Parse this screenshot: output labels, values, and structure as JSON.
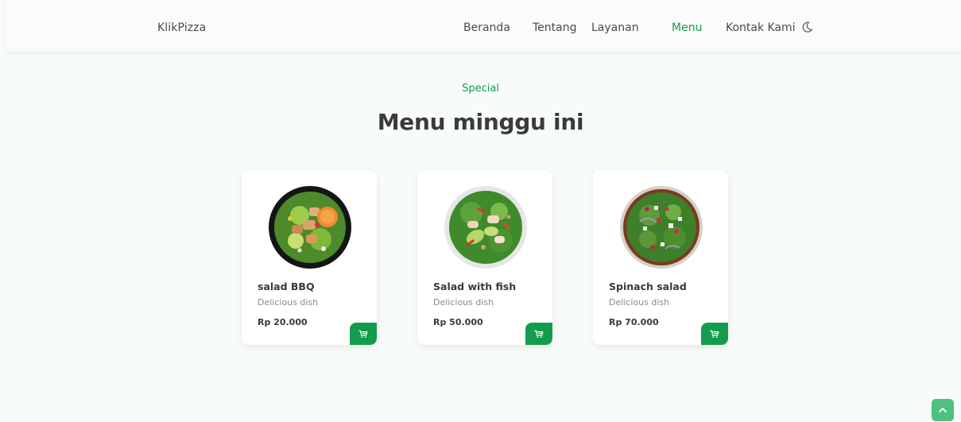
{
  "header": {
    "logo": "KlikPizza",
    "nav": [
      {
        "label": "Beranda"
      },
      {
        "label": "Tentang"
      },
      {
        "label": "Layanan"
      },
      {
        "label": "Menu",
        "active": true
      },
      {
        "label": "Kontak Kami"
      }
    ],
    "theme_toggle_icon": "moon-icon"
  },
  "section": {
    "subtitle": "Special",
    "title": "Menu minggu ini"
  },
  "menu": [
    {
      "name": "salad BBQ",
      "description": "Delicious dish",
      "price": "Rp 20.000",
      "icon": "cart-icon"
    },
    {
      "name": "Salad with fish",
      "description": "Delicious dish",
      "price": "Rp 50.000",
      "icon": "cart-icon"
    },
    {
      "name": "Spinach salad",
      "description": "Delicious dish",
      "price": "Rp 70.000",
      "icon": "cart-icon"
    }
  ],
  "scroll_top_icon": "chevron-up-icon",
  "colors": {
    "accent": "#149c4d",
    "background": "#f7fcf9",
    "scroll_button": "#4fc07f"
  }
}
